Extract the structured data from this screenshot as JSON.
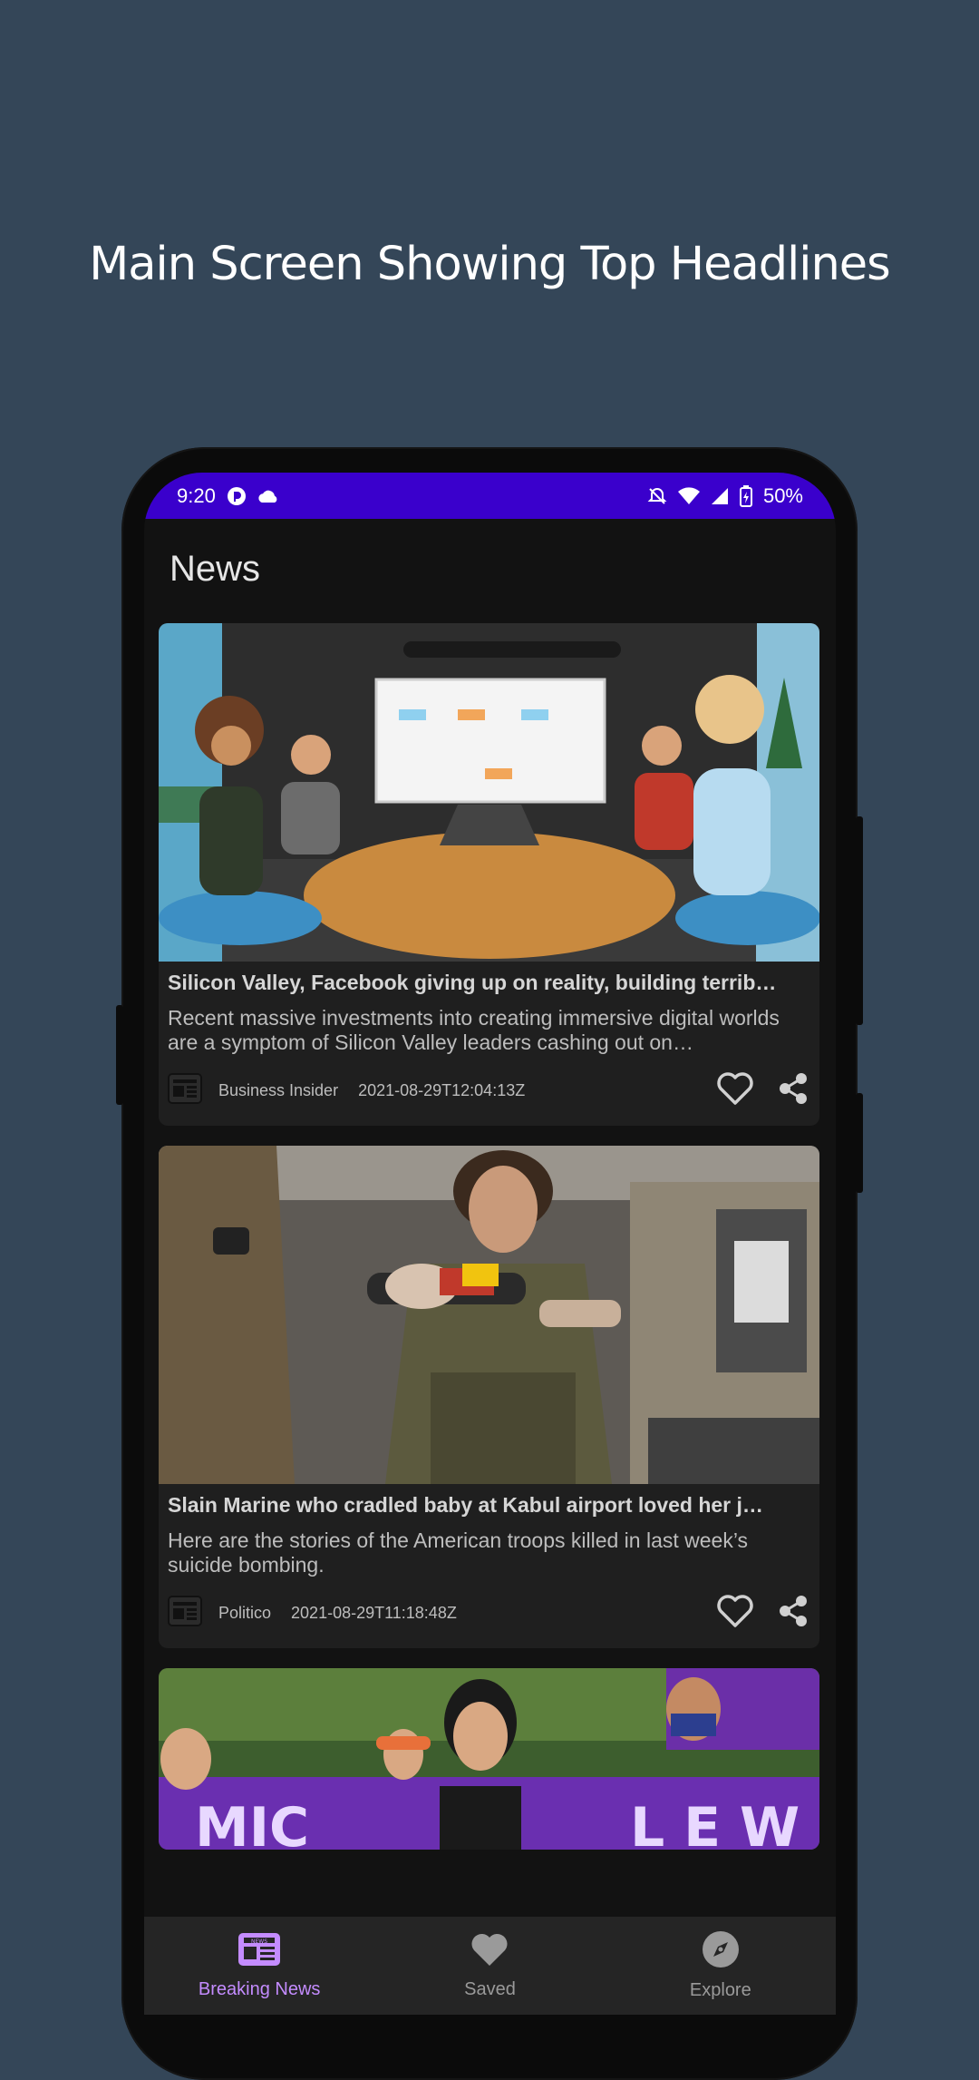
{
  "promo": {
    "title": "Main Screen Showing Top Headlines"
  },
  "status_bar": {
    "time": "9:20",
    "battery": "50%"
  },
  "app_bar": {
    "title": "News"
  },
  "articles": [
    {
      "title": "Silicon Valley, Facebook giving up on reality, building terrib…",
      "description": "Recent massive investments into creating immersive digital worlds are a symptom of Silicon Valley leaders cashing out on…",
      "source": "Business Insider",
      "date": "2021-08-29T12:04:13Z",
      "image": "virtual-meeting-avatars"
    },
    {
      "title": "Slain Marine who cradled baby at Kabul airport loved her j…",
      "description": "Here are the stories of the American troops killed in last week’s suicide bombing.",
      "source": "Politico",
      "date": "2021-08-29T11:18:48Z",
      "image": "marine-holding-baby"
    },
    {
      "title": "",
      "description": "",
      "source": "",
      "date": "",
      "image": "campaign-rally-purple-banners"
    }
  ],
  "bottom_nav": [
    {
      "label": "Breaking News",
      "icon": "newspaper-icon",
      "active": true
    },
    {
      "label": "Saved",
      "icon": "heart-icon",
      "active": false
    },
    {
      "label": "Explore",
      "icon": "compass-icon",
      "active": false
    }
  ],
  "colors": {
    "background": "#344658",
    "status_bar": "#3a00cc",
    "accent": "#c48cff",
    "card": "#1f1f1f"
  }
}
